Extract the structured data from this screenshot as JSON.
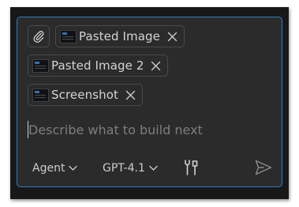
{
  "attachments": [
    {
      "label": "Pasted Image",
      "icon": "image-thumbnail-icon"
    },
    {
      "label": "Pasted Image 2",
      "icon": "image-thumbnail-icon"
    },
    {
      "label": "Screenshot",
      "icon": "image-thumbnail-icon"
    }
  ],
  "input": {
    "placeholder": "Describe what to build next",
    "value": ""
  },
  "toolbar": {
    "mode_label": "Agent",
    "model_label": "GPT-4.1"
  },
  "icons": {
    "attach": "paperclip-icon",
    "close": "close-icon",
    "chevron": "chevron-down-icon",
    "tools": "tools-icon",
    "send": "send-icon"
  },
  "colors": {
    "panel_background": "#2b2b2b",
    "focus_border": "#2d7fc6",
    "text": "#cccccc",
    "placeholder": "#7e7e7e"
  }
}
